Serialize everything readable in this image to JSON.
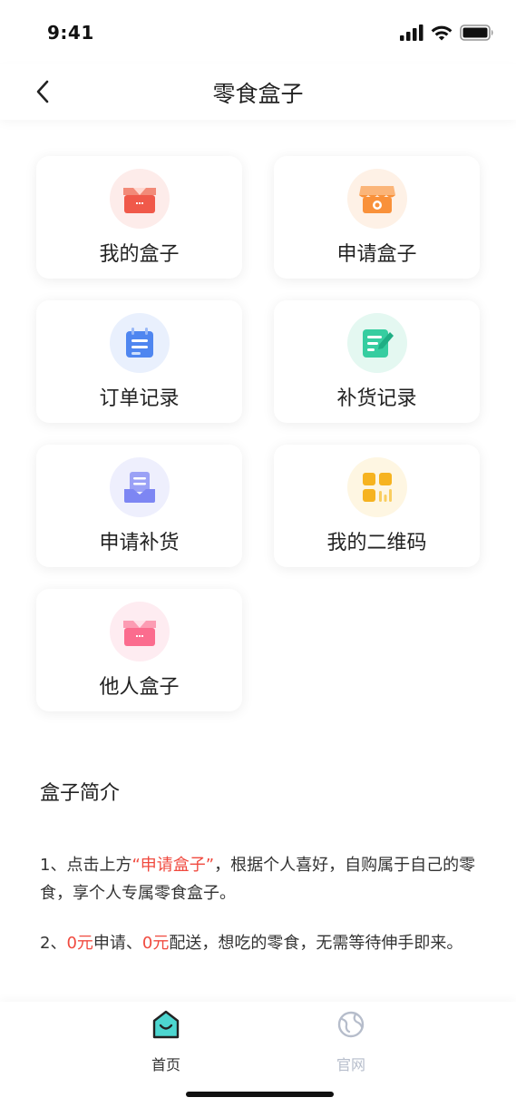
{
  "status_bar": {
    "time": "9:41"
  },
  "nav": {
    "title": "零食盒子"
  },
  "tiles": [
    {
      "label": "我的盒子",
      "icon": "red-box-icon",
      "color": "#f0594a"
    },
    {
      "label": "申请盒子",
      "icon": "shop-stall-icon",
      "color": "#f9913a"
    },
    {
      "label": "订单记录",
      "icon": "calendar-list-icon",
      "color": "#4f86f0"
    },
    {
      "label": "补货记录",
      "icon": "note-edit-icon",
      "color": "#36cda0"
    },
    {
      "label": "申请补货",
      "icon": "inbox-tray-icon",
      "color": "#7d86f3"
    },
    {
      "label": "我的二维码",
      "icon": "qr-grid-icon",
      "color": "#f6b320"
    },
    {
      "label": "他人盒子",
      "icon": "pink-box-icon",
      "color": "#fb6c8e"
    }
  ],
  "intro": {
    "title": "盒子简介",
    "p1_a": "1、点击上方",
    "p1_highlight": "“申请盒子”",
    "p1_b": "，根据个人喜好，自购属于自己的零食，享个人专属零食盒子。",
    "p2_n": "2、",
    "p2_hl1": "0元",
    "p2_mid": "申请、",
    "p2_hl2": "0元",
    "p2_b": "配送，想吃的零食，无需等待伸手即来。"
  },
  "tab_bar": {
    "items": [
      {
        "label": "首页",
        "active": true,
        "color": "#333333"
      },
      {
        "label": "官网",
        "active": false,
        "color": "#b6bdcb"
      }
    ]
  },
  "colors": {
    "highlight": "#f04a3f"
  }
}
